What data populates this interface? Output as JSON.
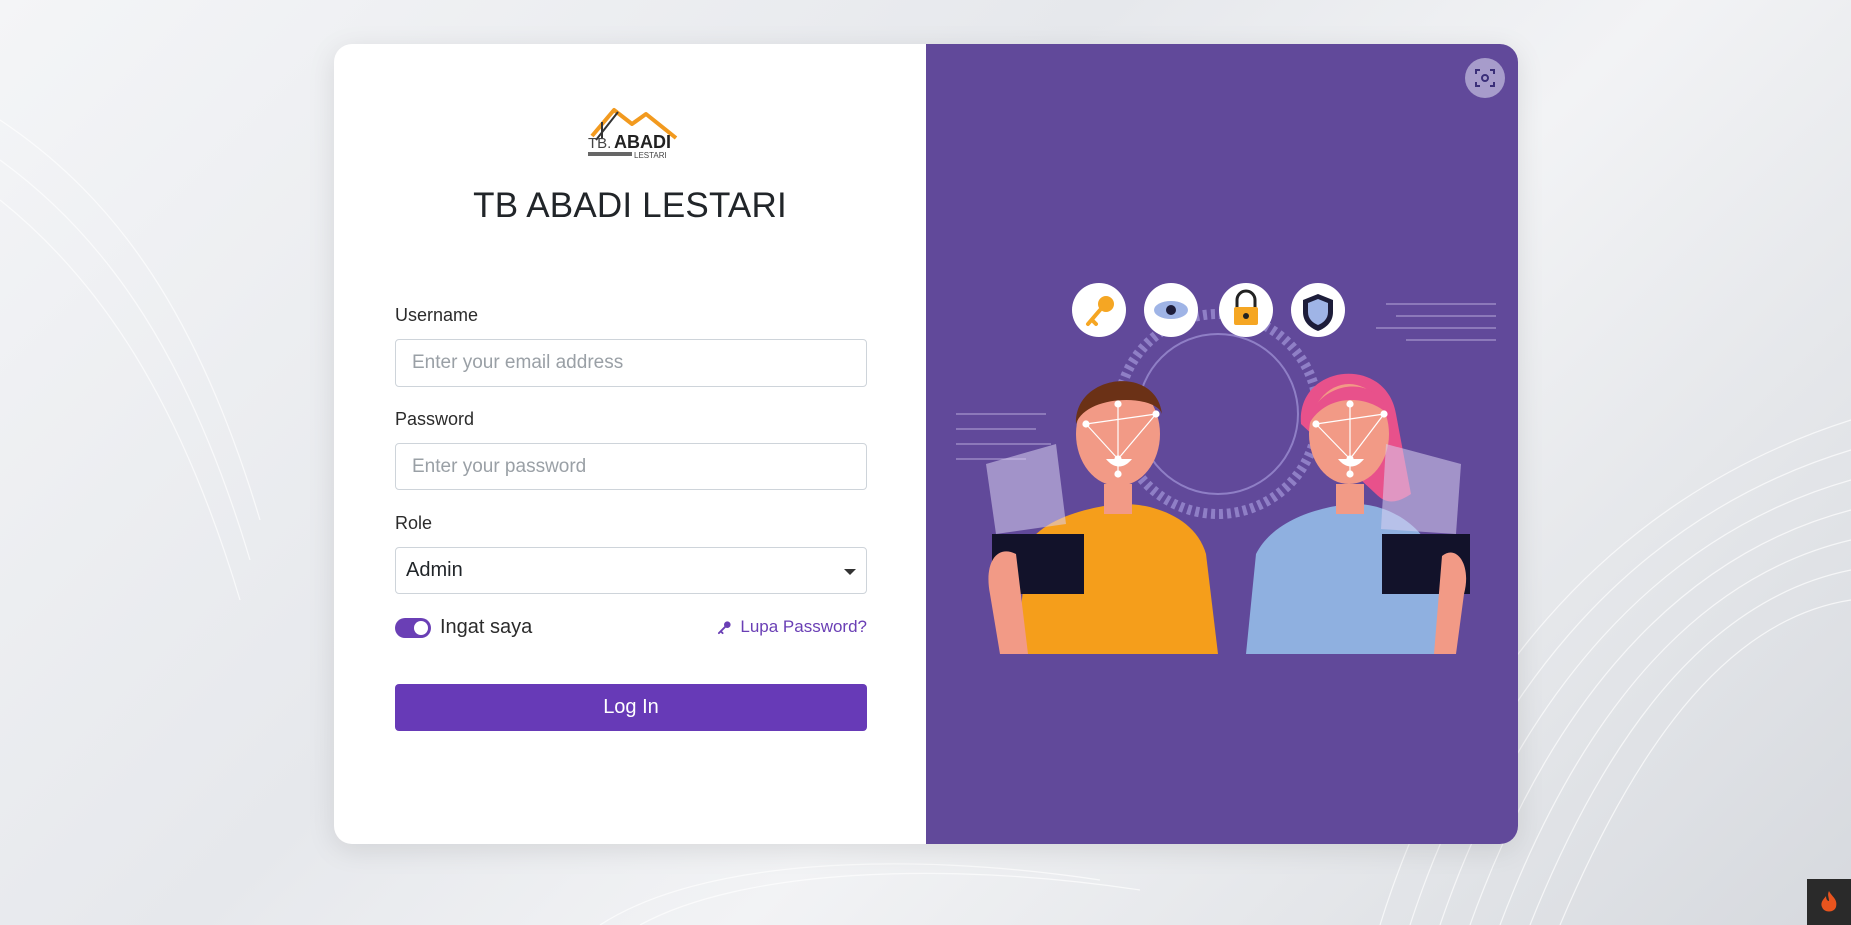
{
  "brand": {
    "logo_text_main": "ABADI",
    "logo_text_prefix": "TB.",
    "logo_text_sub": "LESTARI",
    "title": "TB ABADI LESTARI"
  },
  "form": {
    "username_label": "Username",
    "username_placeholder": "Enter your email address",
    "username_value": "",
    "password_label": "Password",
    "password_placeholder": "Enter your password",
    "password_value": "",
    "role_label": "Role",
    "role_selected": "Admin",
    "remember_label": "Ingat saya",
    "remember_checked": true,
    "forgot_label": "Lupa Password?",
    "submit_label": "Log In"
  },
  "icons": {
    "scan": "face-scan-icon",
    "key": "key-icon",
    "eye": "eye-icon",
    "lock": "lock-icon",
    "shield": "shield-icon",
    "corner": "flame-icon"
  },
  "colors": {
    "accent": "#673ab7",
    "panel": "#61499a"
  }
}
